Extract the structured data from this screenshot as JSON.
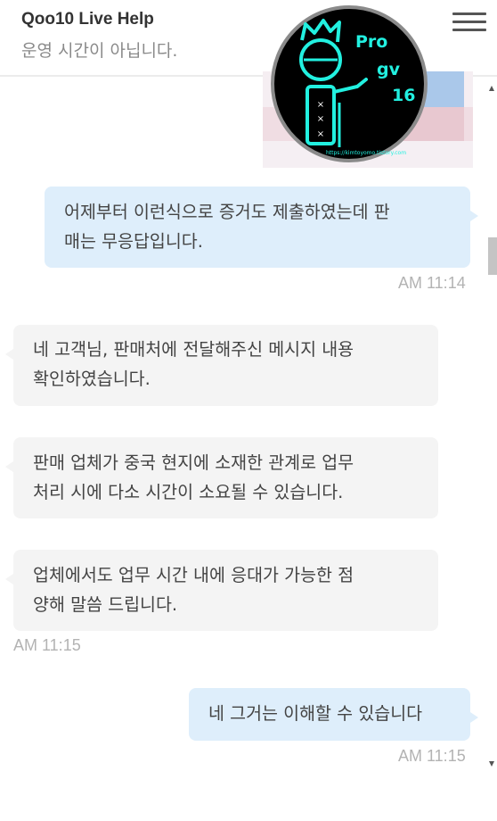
{
  "header": {
    "title": "Qoo10 Live Help",
    "status": "운영 시간이 아닙니다."
  },
  "watermark": {
    "line1": "Pro",
    "line2": "gv",
    "line3": "16",
    "footer": "https://kimtoyomo.tistory.com"
  },
  "messages": [
    {
      "id": "m1",
      "lines": [
        "어제부터 이런식으로 증거도 제출하였는데 판",
        "매는 무응답입니다."
      ],
      "time": "AM 11:14"
    },
    {
      "id": "m2",
      "lines": [
        "네 고객님, 판매처에 전달해주신 메시지 내용",
        "확인하였습니다."
      ]
    },
    {
      "id": "m3",
      "lines": [
        "판매 업체가 중국 현지에 소재한 관계로 업무",
        "처리 시에 다소 시간이 소요될 수 있습니다."
      ]
    },
    {
      "id": "m4",
      "lines": [
        "업체에서도 업무 시간 내에 응대가 가능한 점",
        "양해 말씀 드립니다."
      ],
      "time": "AM 11:15"
    },
    {
      "id": "m5",
      "lines": [
        "네 그거는 이해할 수 있습니다"
      ],
      "time": "AM 11:15"
    }
  ],
  "colors": {
    "outgoing_bubble": "#deeefb",
    "incoming_bubble": "#f4f4f4",
    "timestamp": "#b3b3b3",
    "watermark_neon": "#22f0e0"
  }
}
